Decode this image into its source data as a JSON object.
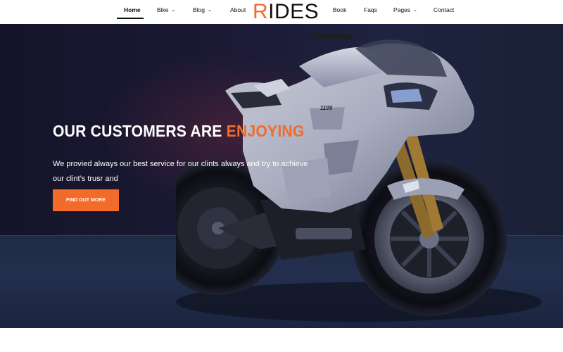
{
  "nav": {
    "left": [
      {
        "label": "Home",
        "dropdown": false,
        "active": true
      },
      {
        "label": "Bike",
        "dropdown": true
      },
      {
        "label": "Blog",
        "dropdown": true
      },
      {
        "label": "About",
        "dropdown": false
      }
    ],
    "right": [
      {
        "label": "Book",
        "dropdown": false
      },
      {
        "label": "Faqs",
        "dropdown": false
      },
      {
        "label": "Pages",
        "dropdown": true
      },
      {
        "label": "Contact",
        "dropdown": false
      }
    ],
    "chevron": "⌄"
  },
  "logo": {
    "accent": "R",
    "rest": "IDES"
  },
  "hero": {
    "headline_main": "OUR CUSTOMERS ARE ",
    "headline_accent": "ENJOYING",
    "subtext": "We provied always our best service for our clints always and try to achieve our clint’s trusr and",
    "cta_label": "FIND OUT MORE",
    "bike_badge": "1199"
  },
  "colors": {
    "accent": "#f26b2a",
    "hero_bg": "#1c1a36"
  }
}
